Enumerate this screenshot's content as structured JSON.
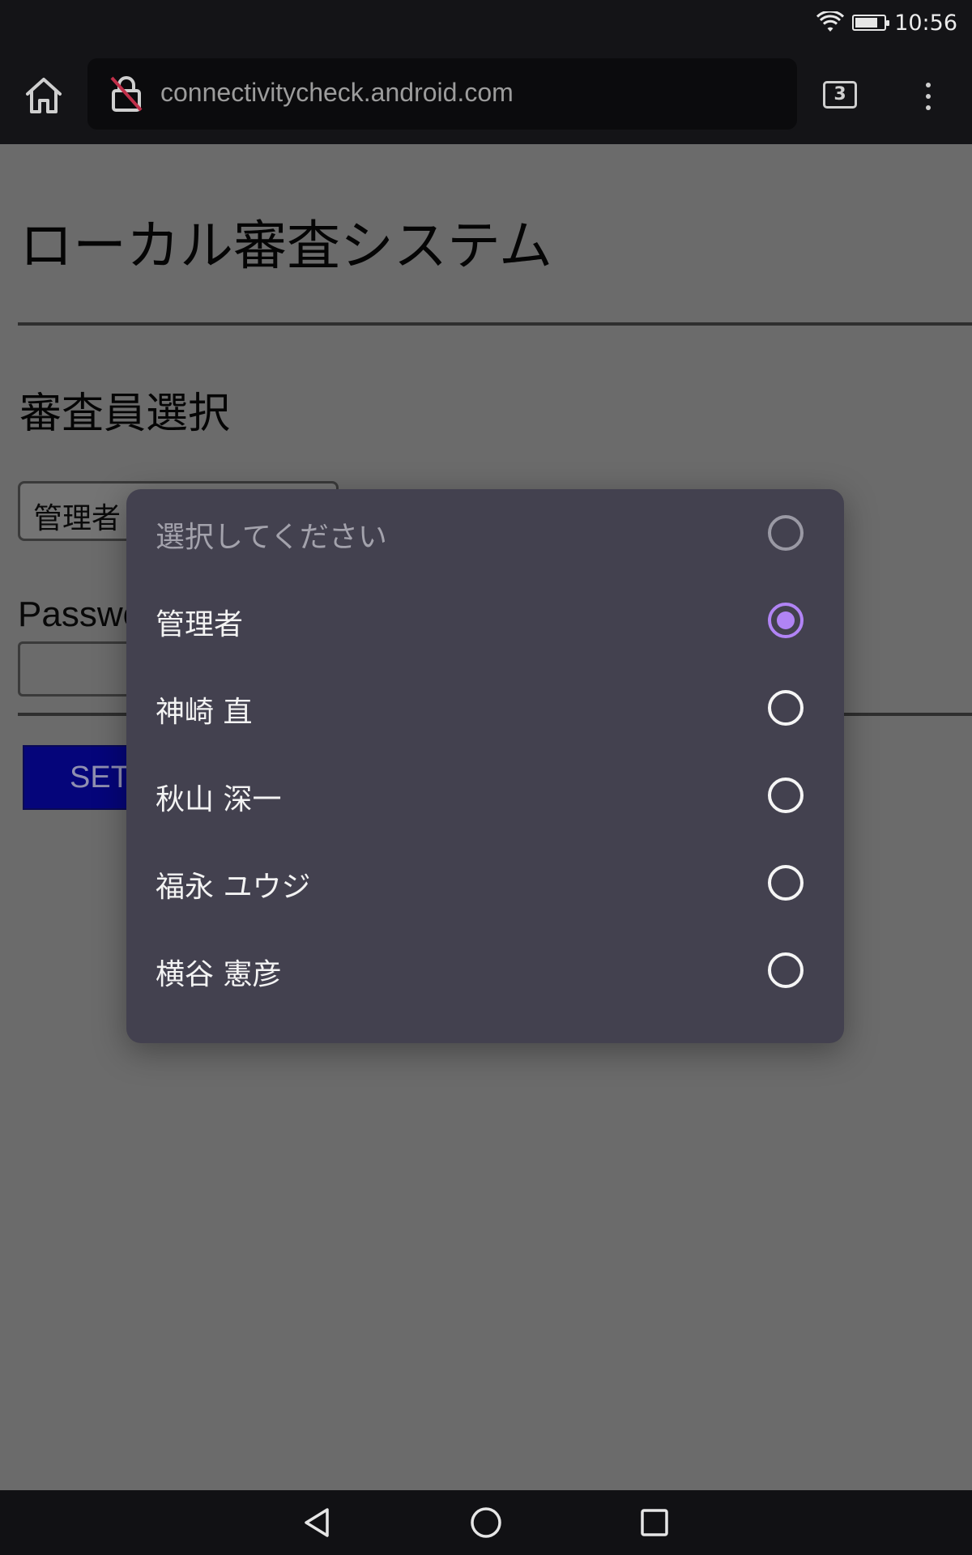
{
  "status_bar": {
    "time": "10:56",
    "battery_level": 0.8
  },
  "browser": {
    "url": "connectivitycheck.android.com",
    "tab_count": "3",
    "icons": {
      "home": "home-icon",
      "lock": "insecure-lock-icon",
      "tabs": "tab-switcher-icon",
      "menu": "more-vert-icon"
    }
  },
  "page": {
    "title": "ローカル審査システム",
    "section_title": "審査員選択",
    "select_value": "管理者",
    "password_label": "Password",
    "set_button_label": "SET"
  },
  "dialog": {
    "options": [
      {
        "label": "選択してください",
        "selected": false,
        "placeholder": true
      },
      {
        "label": "管理者",
        "selected": true,
        "placeholder": false
      },
      {
        "label": "神崎 直",
        "selected": false,
        "placeholder": false
      },
      {
        "label": "秋山 深一",
        "selected": false,
        "placeholder": false
      },
      {
        "label": "福永 ユウジ",
        "selected": false,
        "placeholder": false
      },
      {
        "label": "横谷 憲彦",
        "selected": false,
        "placeholder": false
      }
    ],
    "accent_color": "#b184f5"
  },
  "nav_bar": {
    "icons": [
      "back-icon",
      "home-circle-icon",
      "recents-icon"
    ]
  }
}
